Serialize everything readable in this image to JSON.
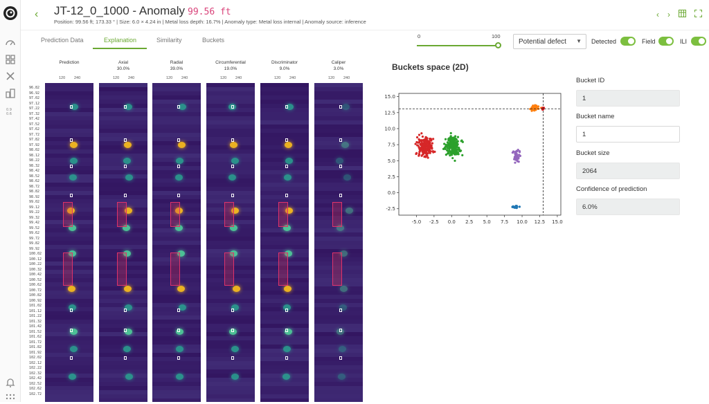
{
  "header": {
    "back": "‹",
    "title": "JT-12_0_1000 - Anomaly",
    "title_value": "99.56 ft",
    "subtitle": "Position: 99.56 ft; 173.33 ° | Size: 6.0 × 4.24 in | Metal loss depth: 16.7% | Anomaly type: Metal loss internal | Anomaly source: inference",
    "nav_prev": "‹",
    "nav_next": "›"
  },
  "tabs": [
    {
      "label": "Prediction Data"
    },
    {
      "label": "Explanation"
    },
    {
      "label": "Similarity"
    },
    {
      "label": "Buckets"
    }
  ],
  "slider": {
    "min_label": "0",
    "max_label": "100",
    "value": 100
  },
  "filter": {
    "selected": "Potential defect"
  },
  "toggles": [
    {
      "label": "Detected",
      "on": true
    },
    {
      "label": "Field",
      "on": true
    },
    {
      "label": "ILI",
      "on": true
    }
  ],
  "heatmap": {
    "columns": [
      {
        "name": "Prediction",
        "pct": ""
      },
      {
        "name": "Axial",
        "pct": "30.0%"
      },
      {
        "name": "Radial",
        "pct": "39.0%"
      },
      {
        "name": "Circumferential",
        "pct": "19.0%"
      },
      {
        "name": "Discriminator",
        "pct": "9.0%"
      },
      {
        "name": "Caliper",
        "pct": "3.0%"
      }
    ],
    "tick_a": "120",
    "tick_b": "240",
    "positions": [
      "96.82",
      "96.92",
      "97.02",
      "97.12",
      "97.22",
      "97.32",
      "97.42",
      "97.52",
      "97.62",
      "97.72",
      "97.82",
      "97.92",
      "98.02",
      "98.12",
      "98.22",
      "98.32",
      "98.42",
      "98.52",
      "98.62",
      "98.72",
      "98.82",
      "98.92",
      "99.02",
      "99.12",
      "99.22",
      "99.32",
      "99.42",
      "99.52",
      "99.62",
      "99.72",
      "99.82",
      "99.92",
      "100.02",
      "100.12",
      "100.22",
      "100.32",
      "100.42",
      "100.52",
      "100.62",
      "100.72",
      "100.82",
      "100.92",
      "101.02",
      "101.12",
      "101.22",
      "101.32",
      "101.42",
      "101.52",
      "101.62",
      "101.72",
      "101.82",
      "101.92",
      "102.02",
      "102.12",
      "102.22",
      "102.32",
      "102.42",
      "102.52",
      "102.62",
      "102.72"
    ]
  },
  "buckets_space": {
    "title": "Buckets space (2D)",
    "chart_data": {
      "type": "scatter",
      "title": "",
      "xlabel": "",
      "ylabel": "",
      "xlim": [
        -7.5,
        15.5
      ],
      "ylim": [
        -3.5,
        15.5
      ],
      "xticks": [
        "-5.0",
        "-2.5",
        "0.0",
        "2.5",
        "5.0",
        "7.5",
        "10.0",
        "12.5",
        "15.0"
      ],
      "yticks": [
        "-2.5",
        "0.0",
        "2.5",
        "5.0",
        "7.5",
        "10.0",
        "12.5",
        "15.0"
      ],
      "crosshair": {
        "x": 13.0,
        "y": 13.1
      },
      "series": [
        {
          "color": "#d62728",
          "center": [
            -3.8,
            7.3
          ],
          "spread": [
            1.6,
            2.2
          ],
          "n": 180
        },
        {
          "color": "#2ca02c",
          "center": [
            0.2,
            7.2
          ],
          "spread": [
            1.6,
            2.3
          ],
          "n": 180
        },
        {
          "color": "#9467bd",
          "center": [
            9.2,
            5.8
          ],
          "spread": [
            0.6,
            1.3
          ],
          "n": 50
        },
        {
          "color": "#1f77b4",
          "center": [
            9.0,
            -2.2
          ],
          "spread": [
            0.7,
            0.25
          ],
          "n": 25
        },
        {
          "color": "#ff7f0e",
          "center": [
            11.8,
            13.2
          ],
          "spread": [
            1.0,
            0.6
          ],
          "n": 45
        },
        {
          "color": "#e41a1c",
          "center": [
            13.0,
            13.1
          ],
          "spread": [
            0.4,
            0.3
          ],
          "n": 8
        }
      ]
    }
  },
  "bucket_panel": {
    "id_label": "Bucket ID",
    "id_value": "1",
    "name_label": "Bucket name",
    "name_value": "1",
    "size_label": "Bucket size",
    "size_value": "2064",
    "conf_label": "Confidence of prediction",
    "conf_value": "6.0%"
  },
  "colors": {
    "accent": "#6aa832",
    "title_value": "#d9437a",
    "heat_bg": "#3a0d5b"
  }
}
